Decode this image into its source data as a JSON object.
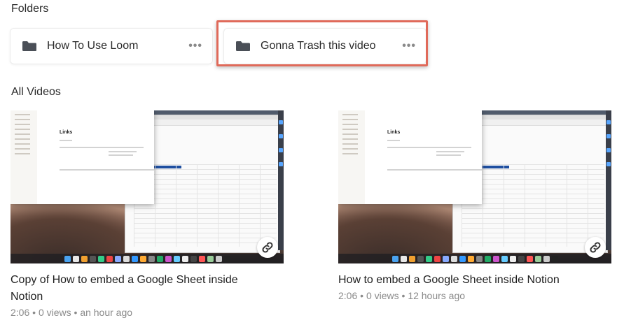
{
  "folders": {
    "title": "Folders",
    "items": [
      {
        "name": "How To Use Loom",
        "icon": "folder-icon",
        "more": "•••"
      },
      {
        "name": "Gonna Trash this video",
        "icon": "folder-icon",
        "more": "•••"
      }
    ]
  },
  "videos": {
    "title": "All Videos",
    "items": [
      {
        "title": "Copy of How to embed a Google Sheet inside Notion",
        "duration": "2:06",
        "views": "0 views",
        "age": "an hour ago",
        "thumbnail_text": "Links",
        "link_icon": "link-icon"
      },
      {
        "title": "How to embed a Google Sheet inside Notion",
        "duration": "2:06",
        "views": "0 views",
        "age": "12 hours ago",
        "thumbnail_text": "Links",
        "link_icon": "link-icon"
      }
    ]
  },
  "colors": {
    "highlight": "#e06a5a",
    "folder_icon": "#4a4f57"
  }
}
